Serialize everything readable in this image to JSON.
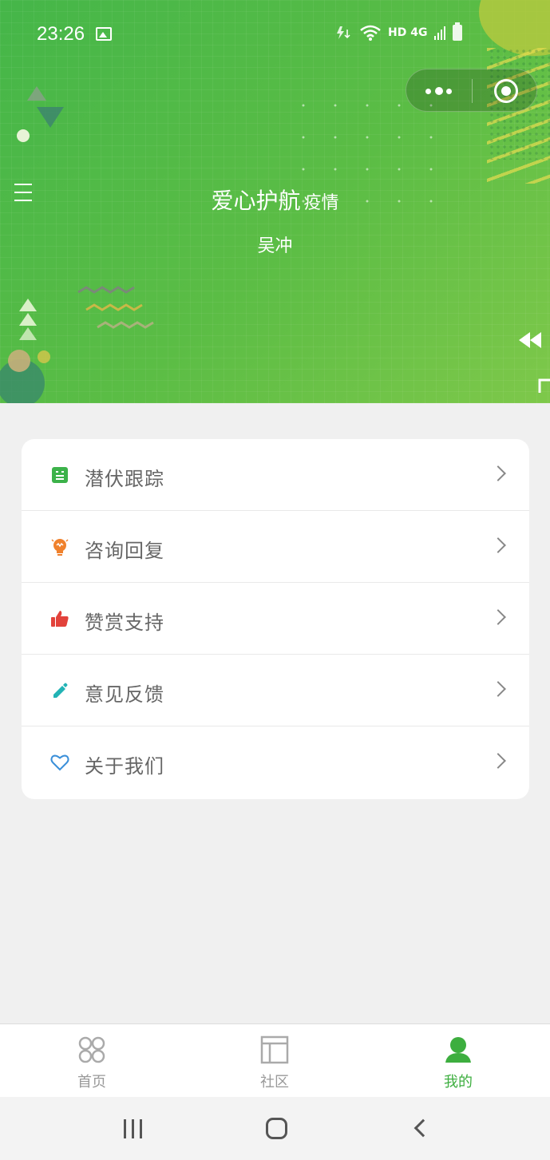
{
  "status_bar": {
    "time": "23:26",
    "indicators": "HD 4G"
  },
  "header": {
    "title_main": "爱心护航",
    "title_sub": "疫情",
    "user_name": "吴冲"
  },
  "menu": [
    {
      "label": "潜伏跟踪",
      "icon": "tracking-icon",
      "icon_color": "#3cb24a"
    },
    {
      "label": "咨询回复",
      "icon": "bulb-icon",
      "icon_color": "#f0812c"
    },
    {
      "label": "赞赏支持",
      "icon": "thumbs-up-icon",
      "icon_color": "#e2423b"
    },
    {
      "label": "意见反馈",
      "icon": "pencil-icon",
      "icon_color": "#22b3b5"
    },
    {
      "label": "关于我们",
      "icon": "heart-icon",
      "icon_color": "#3a8fd9"
    }
  ],
  "tabbar": {
    "items": [
      {
        "label": "首页",
        "icon": "home-grid-icon",
        "active": false
      },
      {
        "label": "社区",
        "icon": "community-icon",
        "active": false
      },
      {
        "label": "我的",
        "icon": "profile-icon",
        "active": true
      }
    ],
    "active_color": "#3dae3f"
  },
  "colors": {
    "header_green": "#4cb848",
    "background": "#f0f0f0"
  }
}
